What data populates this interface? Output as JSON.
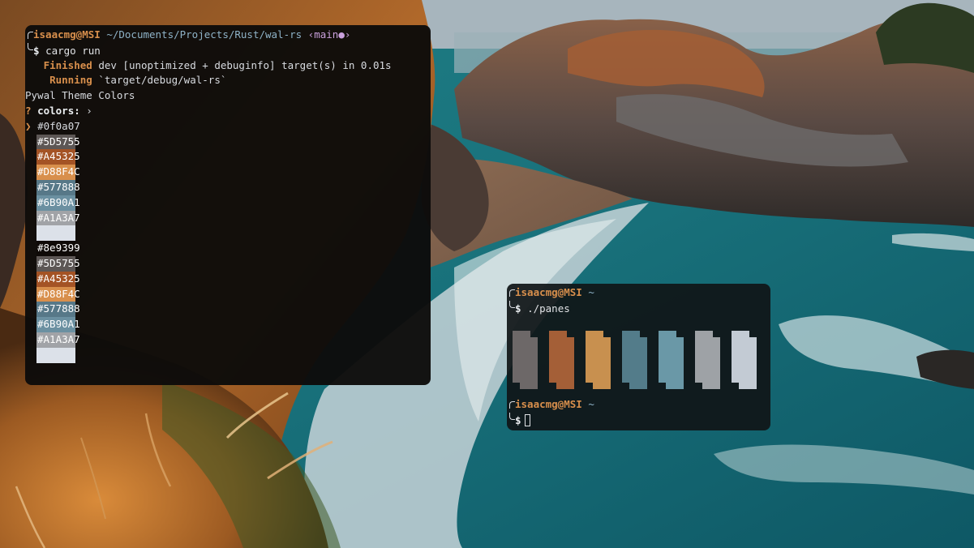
{
  "colors": {
    "bg": "#0f0a07",
    "accent": "#d88f4c",
    "path": "#8fb3c8",
    "branch": "#c9a0dc"
  },
  "main_terminal": {
    "prompt": {
      "user_host": "isaacmg@MSI",
      "path": "~/Documents/Projects/Rust/wal-rs",
      "branch": "‹main●›"
    },
    "command": "cargo run",
    "output": [
      {
        "label": "Finished",
        "text": "dev [unoptimized + debuginfo] target(s) in 0.01s"
      },
      {
        "label": "Running",
        "text": "`target/debug/wal-rs`"
      }
    ],
    "heading": "Pywal Theme Colors",
    "question_mark": "?",
    "question": "colors:",
    "question_arrow": "›",
    "selector": "❯",
    "selected_color": "#0f0a07",
    "swatches": [
      {
        "label": "#5D5755",
        "color": "#5D5755"
      },
      {
        "label": "#A45325",
        "color": "#A45325"
      },
      {
        "label": "#D88F4C",
        "color": "#D88F4C"
      },
      {
        "label": "#577888",
        "color": "#577888"
      },
      {
        "label": "#6B90A1",
        "color": "#6B90A1"
      },
      {
        "label": "#A1A3A7",
        "color": "#A1A3A7"
      },
      {
        "label": "",
        "color": "#DCE1E9"
      },
      {
        "label": "#8e9399",
        "color": "#0f0a07"
      },
      {
        "label": "#5D5755",
        "color": "#5D5755"
      },
      {
        "label": "#A45325",
        "color": "#A45325"
      },
      {
        "label": "#D88F4C",
        "color": "#D88F4C"
      },
      {
        "label": "#577888",
        "color": "#577888"
      },
      {
        "label": "#6B90A1",
        "color": "#6B90A1"
      },
      {
        "label": "#A1A3A7",
        "color": "#A1A3A7"
      },
      {
        "label": "",
        "color": "#DCE1E9"
      }
    ]
  },
  "panes_terminal": {
    "prompt1": {
      "user_host": "isaacmg@MSI",
      "path": "~"
    },
    "command": "./panes",
    "pane_colors": [
      "#6d6868",
      "#a45f37",
      "#c8904f",
      "#537c8a",
      "#6a98a7",
      "#9ea2a6",
      "#c3cbd4"
    ],
    "prompt2": {
      "user_host": "isaacmg@MSI",
      "path": "~"
    }
  },
  "prompt_symbol": "$"
}
